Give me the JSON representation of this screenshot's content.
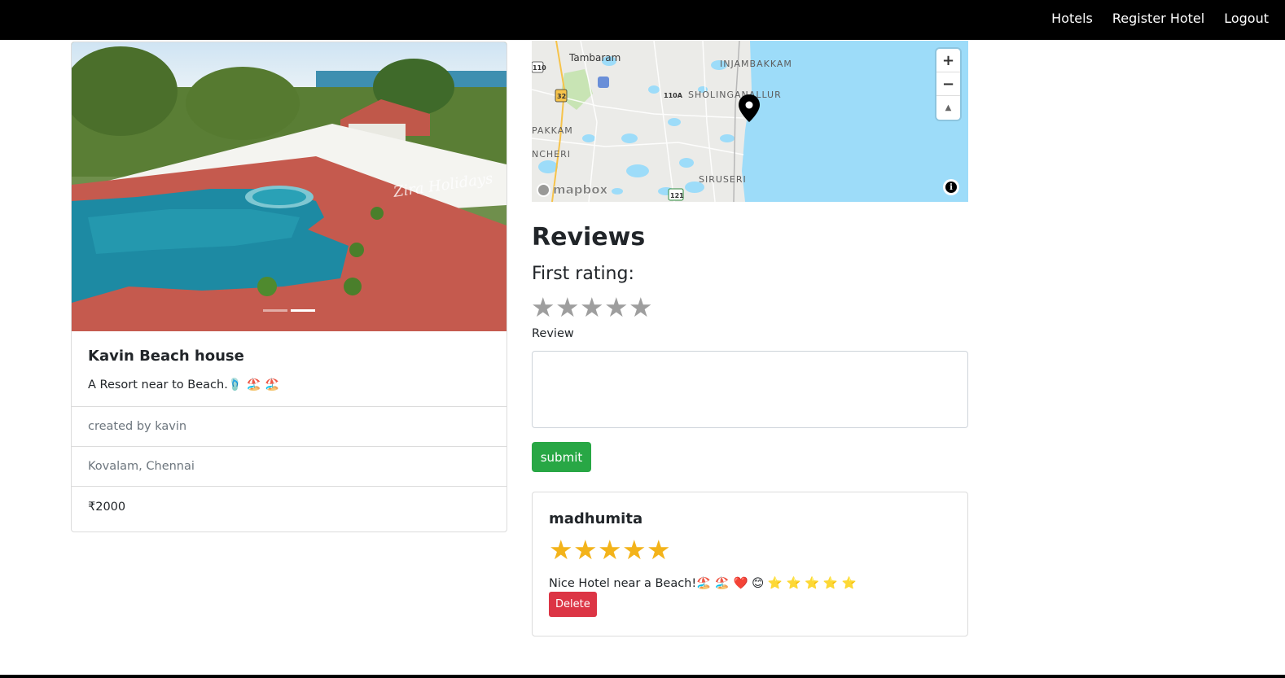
{
  "nav": {
    "links": [
      "Hotels",
      "Register Hotel",
      "Logout"
    ]
  },
  "hotel": {
    "title": "Kavin Beach house",
    "description": "A Resort near to Beach.🩴 🏖️ 🏖️",
    "created_by": "created by kavin",
    "location": "Kovalam, Chennai",
    "price": "₹2000",
    "image_watermark": "Zira Holidays"
  },
  "map": {
    "labels": [
      "Tambaram",
      "INJAMBAKKAM",
      "SHOLINGANALLUR",
      "PAKKAM",
      "NCHERI",
      "SIRUSERI"
    ],
    "road_badges": [
      "110",
      "32",
      "110A",
      "121"
    ],
    "zoom_in": "+",
    "zoom_out": "−",
    "compass": "▲",
    "attribution_logo": "mapbox",
    "info": "i"
  },
  "reviews": {
    "heading": "Reviews",
    "rating_label": "First rating:",
    "review_label": "Review",
    "submit_label": "submit",
    "items": [
      {
        "author": "madhumita",
        "rating": 5,
        "text": "Nice Hotel near a Beach!🏖️ 🏖️ ❤️ 😊 ⭐ ⭐ ⭐ ⭐ ⭐",
        "delete_label": "Delete"
      }
    ]
  },
  "colors": {
    "navbar": "#000000",
    "submit": "#28a745",
    "delete": "#dc3545",
    "star_filled": "#f3b31a",
    "star_empty": "#9e9e9e",
    "water": "#9ddcf9"
  }
}
